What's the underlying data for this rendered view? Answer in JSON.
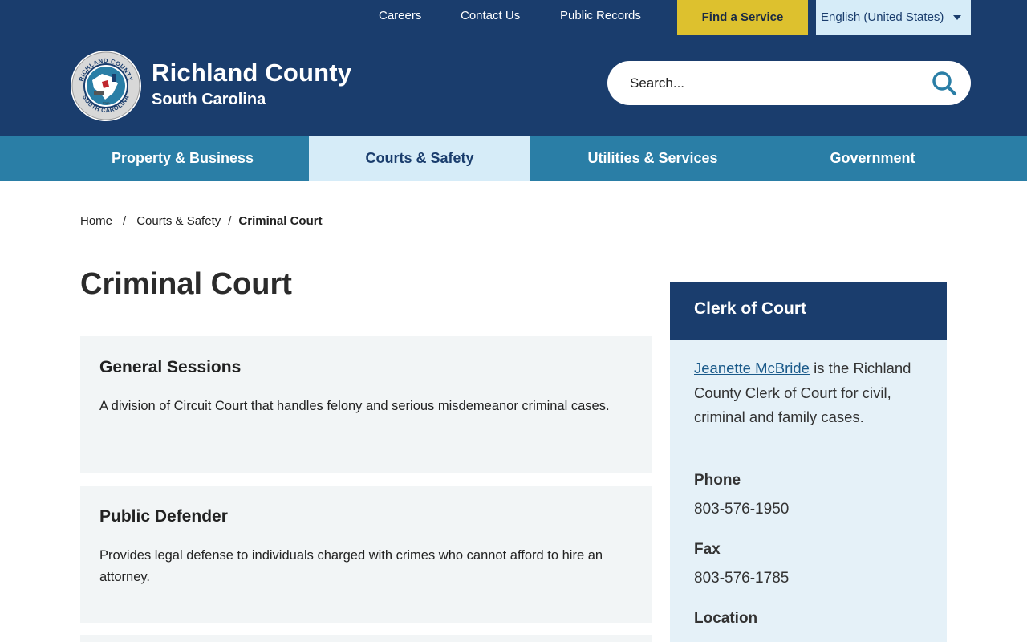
{
  "topbar": {
    "links": [
      "Careers",
      "Contact Us",
      "Public Records"
    ],
    "find_service": "Find a Service",
    "language": "English (United States)"
  },
  "header": {
    "title": "Richland County",
    "subtitle": "South Carolina",
    "seal_text_top": "RICHLAND COUNTY",
    "seal_text_bottom": "SOUTH CAROLINA",
    "seal_year": "1799",
    "search_placeholder": "Search..."
  },
  "nav": {
    "items": [
      "Property & Business",
      "Courts & Safety",
      "Utilities & Services",
      "Government"
    ],
    "active": "Courts & Safety"
  },
  "breadcrumb": {
    "home": "Home",
    "section": "Courts & Safety",
    "current": "Criminal Court",
    "separator": "/"
  },
  "page": {
    "title": "Criminal Court",
    "cards": [
      {
        "title": "General Sessions",
        "description": "A division of Circuit Court that handles felony and serious misdemeanor criminal cases."
      },
      {
        "title": "Public Defender",
        "description": "Provides legal defense to individuals charged with crimes who cannot afford to hire an attorney."
      }
    ]
  },
  "sidebar": {
    "title": "Clerk of Court",
    "clerk_name": "Jeanette McBride",
    "clerk_text": " is the Richland County Clerk of Court for civil, criminal and family cases.",
    "phone_label": "Phone",
    "phone": "803-576-1950",
    "fax_label": "Fax",
    "fax": "803-576-1785",
    "location_label": "Location"
  },
  "colors": {
    "navy": "#1a3d6d",
    "teal_nav": "#2a7ea6",
    "active_tab": "#d6ecf8",
    "gold_button": "#ddc12e",
    "card_bg": "#f2f5f6",
    "sidebar_bg": "#e5f1f8",
    "link": "#1a5a8a"
  },
  "icons": {
    "search": "magnifier-icon",
    "caret": "chevron-down-icon",
    "seal": "county-seal-icon"
  }
}
